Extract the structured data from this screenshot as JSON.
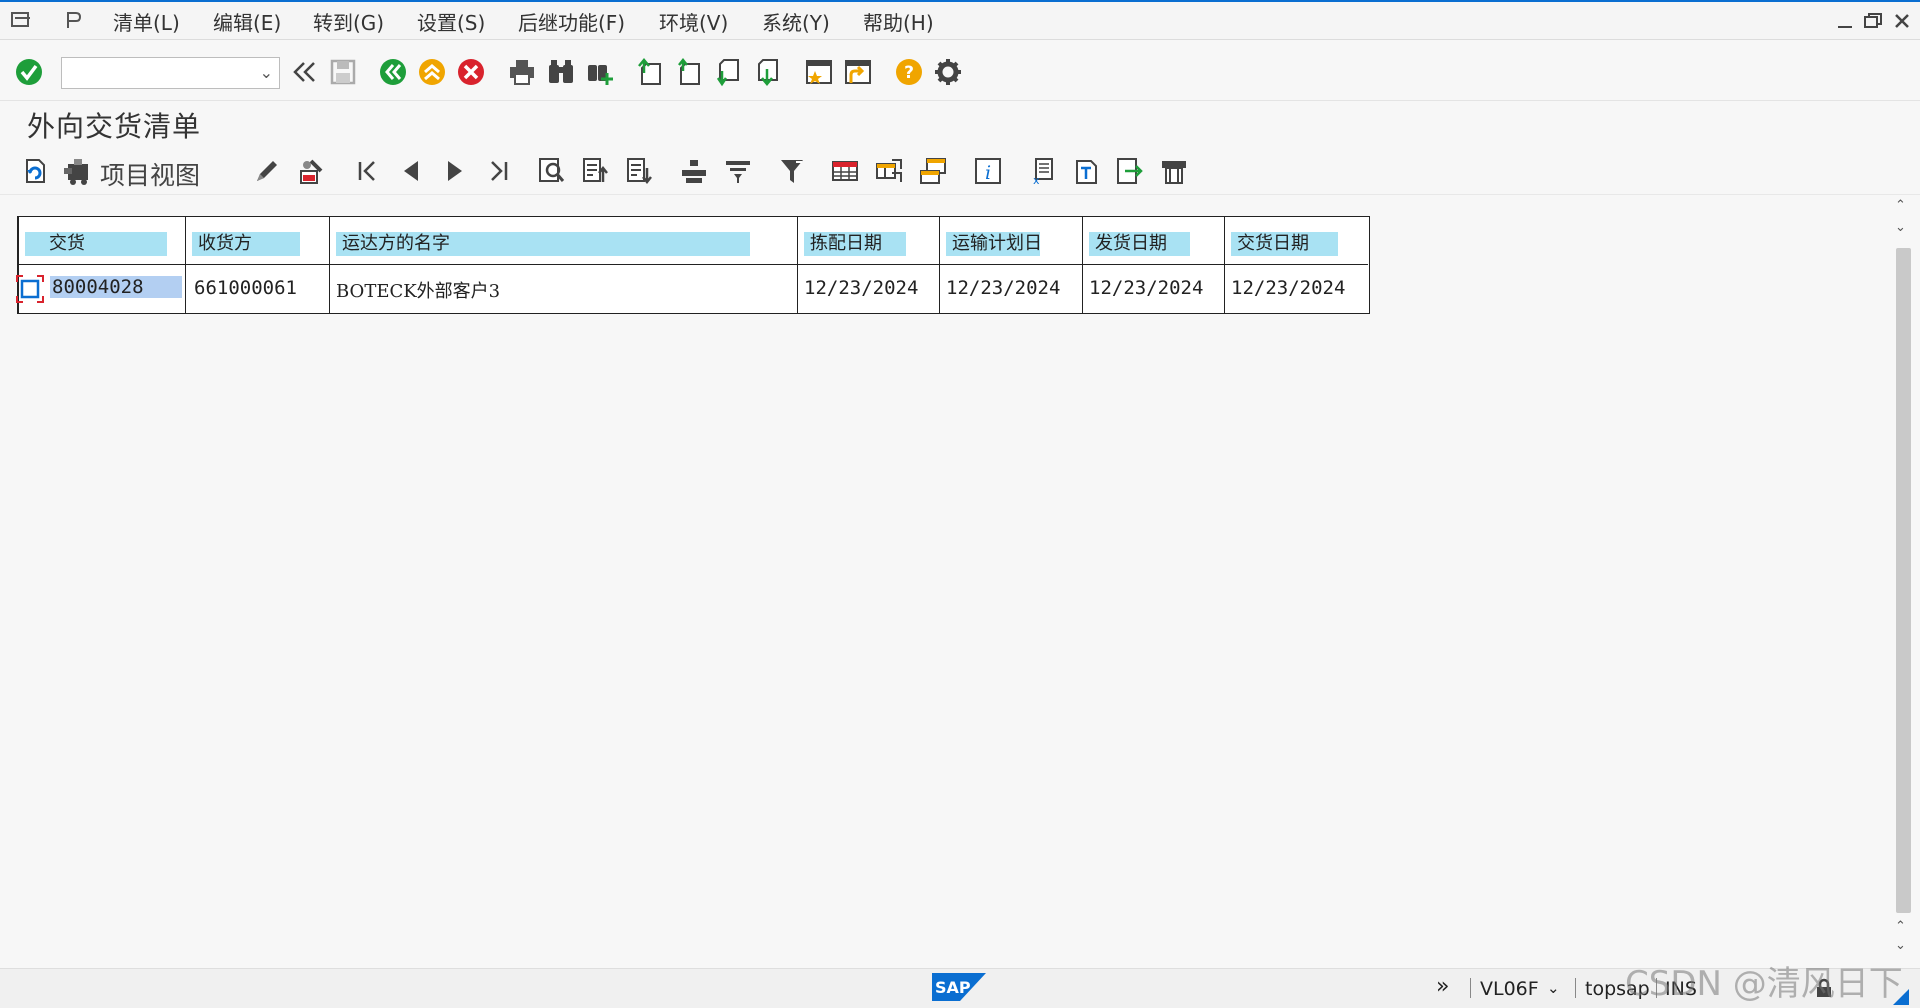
{
  "menu": [
    "清单(L)",
    "编辑(E)",
    "转到(G)",
    "设置(S)",
    "后继功能(F)",
    "环境(V)",
    "系统(Y)",
    "帮助(H)"
  ],
  "toolbar": {
    "command_field_value": ""
  },
  "page_title": "外向交货清单",
  "app_toolbar": {
    "item_view_label": "项目视图"
  },
  "table": {
    "headers": [
      "交货",
      "收货方",
      "运达方的名字",
      "拣配日期",
      "运输计划日",
      "发货日期",
      "交货日期"
    ],
    "rows": [
      [
        "80004028",
        "661000061",
        "BOTECK外部客户3",
        "12/23/2024",
        "12/23/2024",
        "12/23/2024",
        "12/23/2024"
      ]
    ]
  },
  "status": {
    "transaction": "VL06F",
    "server": "topsap",
    "mode": "INS"
  },
  "watermark": "CSDN @清风日下",
  "colors": {
    "accent": "#0a6ed1",
    "header_highlight": "#a9e2f3",
    "selected_cell": "#b3cff2"
  },
  "icons": [
    "enter-icon",
    "back-icon",
    "exit-icon",
    "cancel-icon",
    "print-icon",
    "find-icon",
    "find-next-icon",
    "first-page-icon",
    "previous-page-icon",
    "next-page-icon",
    "last-page-icon",
    "create-session-icon",
    "shortcut-icon",
    "help-icon",
    "customize-icon"
  ]
}
